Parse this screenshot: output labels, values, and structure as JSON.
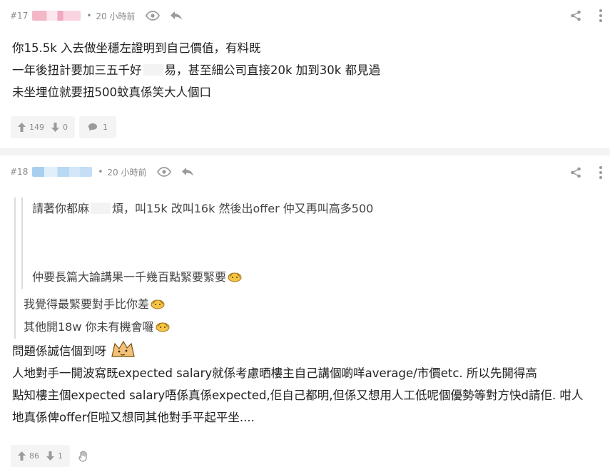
{
  "posts": [
    {
      "number": "#17",
      "username": "",
      "separator": "•",
      "time": "20 小時前",
      "lines": [
        "你15.5k 入去做坐穩左證明到自己價值，有料既",
        "一年後扭計要加三五千好",
        "易，甚至細公司直接20k 加到30k 都見過",
        "未坐埋位就要扭500蚊真係笑大人個口"
      ],
      "upvotes": "149",
      "downvotes": "0",
      "replies": "1"
    },
    {
      "number": "#18",
      "username": "",
      "separator": "•",
      "time": "20 小時前",
      "quote_inner": [
        "請著你都麻",
        "煩，叫15k 改叫16k 然後出offer 仲又再叫高多500",
        "仲要長篇大論講果一千幾百點緊要緊要"
      ],
      "quote_outer": [
        "我覺得最緊要對手比你差",
        "其他開18w 你未有機會囉"
      ],
      "lines": [
        "問題係誠信個到呀",
        "人地對手一開波寫既expected salary就係考慮晒樓主自己講個啲咩average/市價etc. 所以先開得高",
        "點知樓主個expected salary唔係真係expected,佢自己都明,但係又想用人工低呢個優勢等對方快d請佢. 咁人",
        "地真係俾offer佢啦又想同其他對手平起平坐...."
      ],
      "upvotes": "86",
      "downvotes": "1"
    }
  ],
  "icons": {
    "eye": "eye-icon",
    "reply": "reply-arrow-icon",
    "share": "share-icon",
    "more": "more-vertical-icon",
    "upvote": "arrow-up-icon",
    "downvote": "arrow-down-icon",
    "comment": "comment-bubble-icon",
    "block": "hand-icon"
  },
  "colors": {
    "meta_text": "#8a8a8a",
    "icon": "#9a9a9a",
    "separator": "#f3f3f3"
  }
}
